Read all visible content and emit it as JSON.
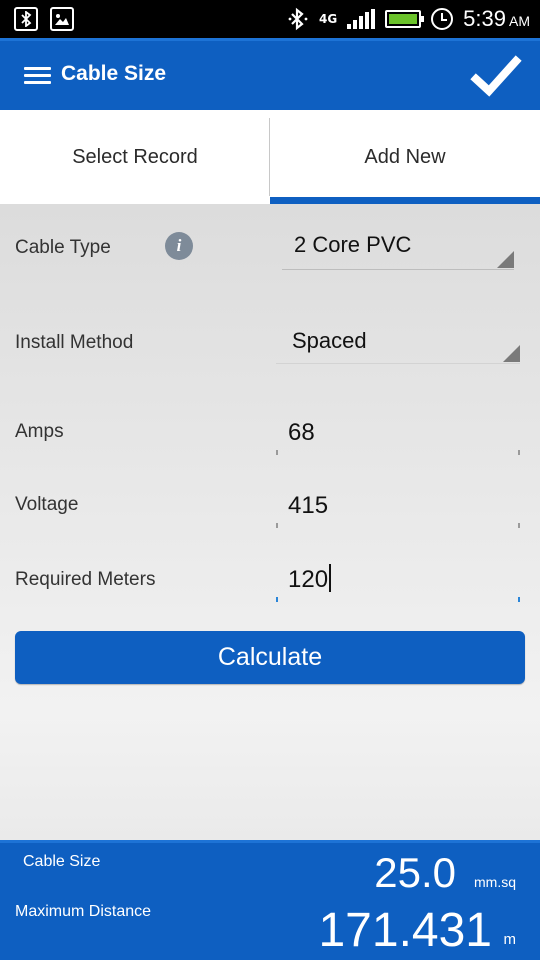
{
  "status_bar": {
    "left_icons": [
      "bluetooth-notification-icon",
      "image-notification-icon"
    ],
    "right_icons": [
      "bluetooth-icon",
      "network-4g-icon",
      "signal-icon",
      "battery-icon",
      "alarm-icon"
    ],
    "network": "4G",
    "time": "5:39",
    "ampm": "AM",
    "battery_color": "#6bc22a"
  },
  "app_bar": {
    "title": "Cable Size",
    "menu_icon": "hamburger-menu-icon",
    "action_icon": "checkmark-icon",
    "color": "#0e5fc1"
  },
  "tabs": [
    {
      "label": "Select Record",
      "selected": false
    },
    {
      "label": "Add New",
      "selected": true
    }
  ],
  "form": {
    "cable_type": {
      "label": "Cable Type",
      "value": "2 Core PVC",
      "info_icon": "i"
    },
    "install_method": {
      "label": "Install Method",
      "value": "Spaced"
    },
    "amps": {
      "label": "Amps",
      "value": "68"
    },
    "voltage": {
      "label": "Voltage",
      "value": "415"
    },
    "required_meters": {
      "label": "Required Meters",
      "value": "120"
    },
    "calculate_label": "Calculate"
  },
  "results": {
    "cable_size": {
      "label": "Cable Size",
      "value": "25.0",
      "unit": "mm.sq"
    },
    "max_distance": {
      "label": "Maximum Distance",
      "value": "171.431",
      "unit": "m"
    }
  }
}
